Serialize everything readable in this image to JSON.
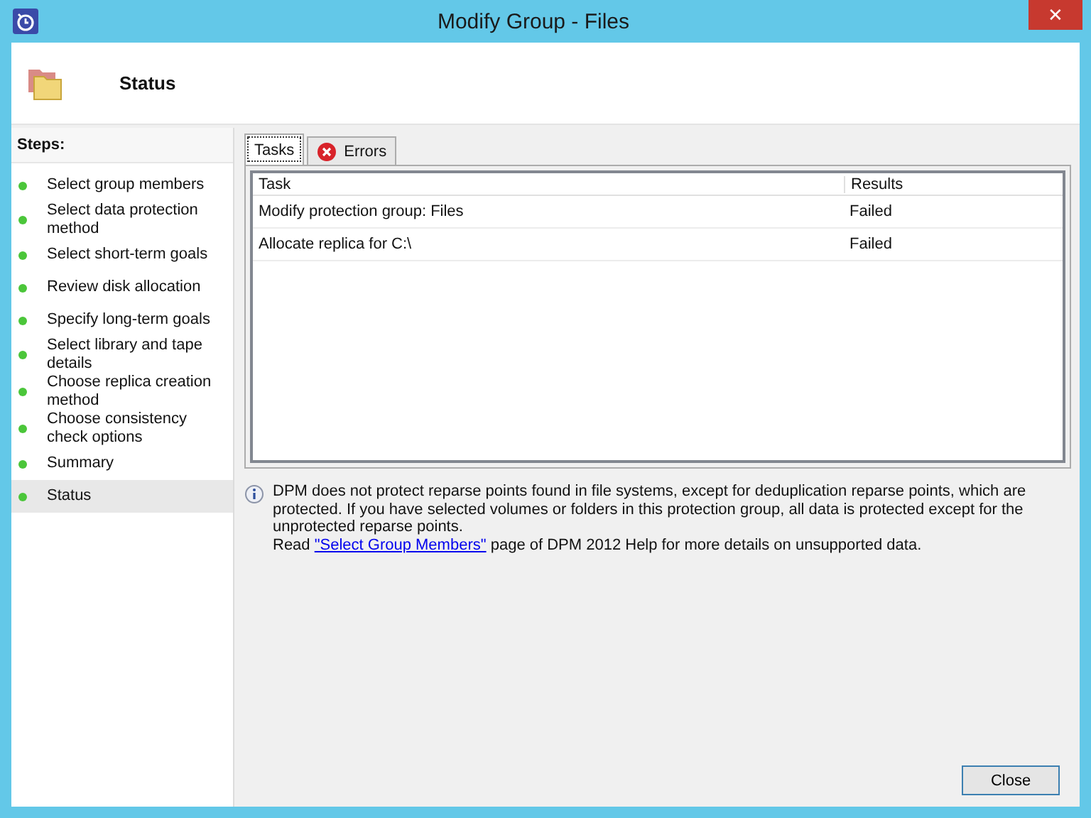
{
  "window": {
    "title": "Modify Group - Files",
    "close": "✕"
  },
  "header": {
    "title": "Status"
  },
  "steps": {
    "heading": "Steps:",
    "items": [
      {
        "label": "Select group members",
        "selected": false
      },
      {
        "label": "Select data protection method",
        "selected": false
      },
      {
        "label": "Select short-term goals",
        "selected": false
      },
      {
        "label": "Review disk allocation",
        "selected": false
      },
      {
        "label": "Specify long-term goals",
        "selected": false
      },
      {
        "label": "Select library and tape details",
        "selected": false
      },
      {
        "label": "Choose replica creation method",
        "selected": false
      },
      {
        "label": "Choose consistency check options",
        "selected": false
      },
      {
        "label": "Summary",
        "selected": false
      },
      {
        "label": "Status",
        "selected": true
      }
    ]
  },
  "tabs": [
    {
      "label": "Tasks",
      "selected": true,
      "kind": "plain"
    },
    {
      "label": "Errors",
      "selected": false,
      "kind": "error"
    }
  ],
  "table": {
    "columns": [
      "Task",
      "Results"
    ],
    "rows": [
      {
        "task": "Modify protection group: Files",
        "result": "Failed"
      },
      {
        "task": "Allocate replica for C:\\",
        "result": "Failed"
      }
    ]
  },
  "note": {
    "text": "DPM does not protect reparse points found in file systems, except for deduplication reparse points, which are protected. If you have selected volumes or folders in this protection group, all data is protected except for the unprotected reparse points.",
    "before": "Read",
    "link": "\"Select Group Members\"",
    "after": "page of DPM 2012 Help for more details on unsupported data."
  },
  "buttons": [
    {
      "label": "Close"
    }
  ]
}
